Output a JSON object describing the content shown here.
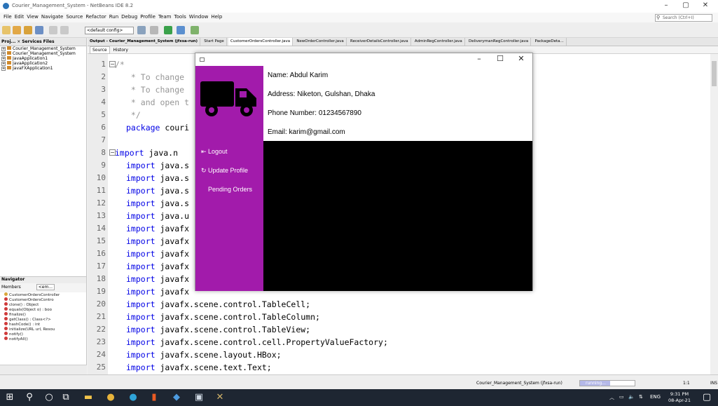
{
  "ide": {
    "title": "Courier_Management_System - NetBeans IDE 8.2",
    "menu": [
      "File",
      "Edit",
      "View",
      "Navigate",
      "Source",
      "Refactor",
      "Run",
      "Debug",
      "Profile",
      "Team",
      "Tools",
      "Window",
      "Help"
    ],
    "search_placeholder": "Search (Ctrl+I)",
    "config": "<default config>",
    "left_tabs": [
      "Proj...",
      "Services",
      "Files"
    ],
    "tree": [
      "Courier_Management_System",
      "Courier_Management_System",
      "JavaApplication1",
      "JavaApplication2",
      "JavaFXApplication1"
    ],
    "navigator_title": "Navigator",
    "members_label": "Members",
    "members_select": "<em...",
    "nav_items": [
      "CustomerOrdersController",
      "CustomerOrdersContro",
      "clone() : Object",
      "equals(Object o) : boo",
      "finalize()",
      "getClass() : Class<?>",
      "hashCode() : int",
      "initialize(URL url, Resou",
      "notify()",
      "notifyAll()"
    ],
    "editor_tabs": [
      "Output - Courier_Management_System (jfxsa-run)",
      "Start Page",
      "CustomerOrdersController.java",
      "NewOrderController.java",
      "ReceiverDetailsController.java",
      "AdminRegController.java",
      "DeliverymanRegController.java",
      "PackageDeta..."
    ],
    "source_tab": "Source",
    "history_tab": "History",
    "code_lines": [
      {
        "n": "1",
        "t": "/*"
      },
      {
        "n": "2",
        "t": " * To change"
      },
      {
        "n": "3",
        "t": " * To change"
      },
      {
        "n": "4",
        "t": " * and open t"
      },
      {
        "n": "5",
        "t": " */"
      },
      {
        "n": "6",
        "t": "package couri"
      },
      {
        "n": "7",
        "t": ""
      },
      {
        "n": "8",
        "t": "import java.n"
      },
      {
        "n": "9",
        "t": "import java.s"
      },
      {
        "n": "10",
        "t": "import java.s"
      },
      {
        "n": "11",
        "t": "import java.s"
      },
      {
        "n": "12",
        "t": "import java.s"
      },
      {
        "n": "13",
        "t": "import java.u"
      },
      {
        "n": "14",
        "t": "import javafx"
      },
      {
        "n": "15",
        "t": "import javafx"
      },
      {
        "n": "16",
        "t": "import javafx"
      },
      {
        "n": "17",
        "t": "import javafx"
      },
      {
        "n": "18",
        "t": "import javafx"
      },
      {
        "n": "19",
        "t": "import javafx"
      },
      {
        "n": "20",
        "t": "import javafx.scene.control.TableCell;"
      },
      {
        "n": "21",
        "t": "import javafx.scene.control.TableColumn;"
      },
      {
        "n": "22",
        "t": "import javafx.scene.control.TableView;"
      },
      {
        "n": "23",
        "t": "import javafx.scene.control.cell.PropertyValueFactory;"
      },
      {
        "n": "24",
        "t": "import javafx.scene.layout.HBox;"
      },
      {
        "n": "25",
        "t": "import javafx.scene.text.Text;"
      }
    ],
    "status_project": "Courier_Management_System (jfxsa-run)",
    "status_running": "running...",
    "status_progress": 0.55,
    "status_pos": "1:1",
    "status_ins": "INS"
  },
  "app": {
    "info": {
      "name": "Name: Abdul Karim",
      "address": "Address: Niketon, Gulshan, Dhaka",
      "phone": "Phone Number: 01234567890",
      "email": "Email: karim@gmail.com"
    },
    "menu": {
      "logout": "Logout",
      "update_profile": "Update Profile",
      "pending_orders": "Pending Orders"
    },
    "colors": {
      "sidebar": "#a21bab",
      "content": "#000000"
    }
  },
  "taskbar": {
    "lang": "ENG",
    "time": "9:31 PM",
    "date": "08-Apr-21"
  }
}
